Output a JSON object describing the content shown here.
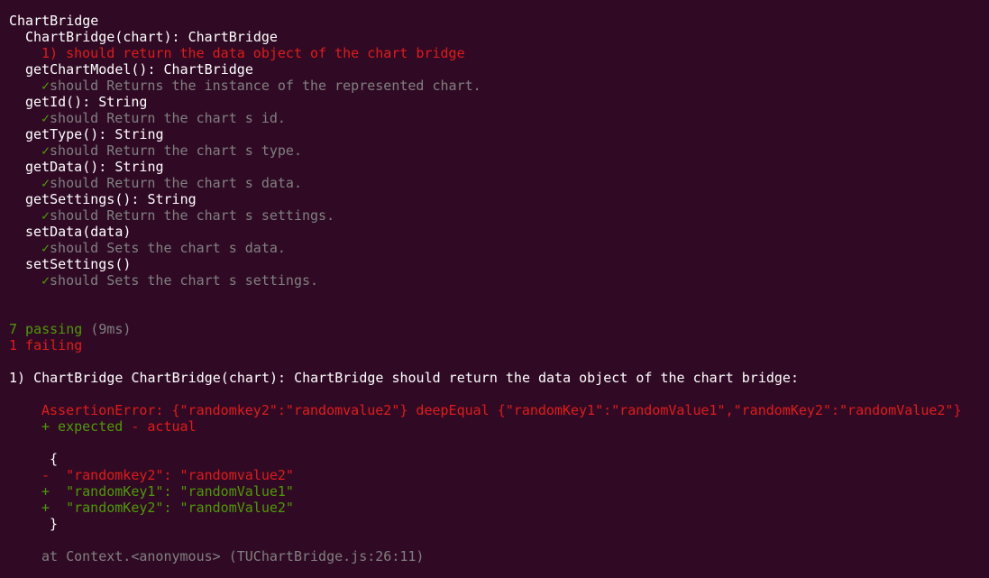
{
  "suite": {
    "title": "ChartBridge",
    "groups": [
      {
        "heading": "ChartBridge(chart): ChartBridge",
        "status": "fail",
        "marker": "1)",
        "test": "should return the data object of the chart bridge"
      },
      {
        "heading": "getChartModel(): ChartBridge",
        "status": "pass",
        "marker": "✓",
        "test": "should Returns the instance of the represented chart."
      },
      {
        "heading": "getId(): String",
        "status": "pass",
        "marker": "✓",
        "test": "should Return the chart s id."
      },
      {
        "heading": "getType(): String",
        "status": "pass",
        "marker": "✓",
        "test": "should Return the chart s type."
      },
      {
        "heading": "getData(): String",
        "status": "pass",
        "marker": "✓",
        "test": "should Return the chart s data."
      },
      {
        "heading": "getSettings(): String",
        "status": "pass",
        "marker": "✓",
        "test": "should Return the chart s settings."
      },
      {
        "heading": "setData(data)",
        "status": "pass",
        "marker": "✓",
        "test": "should Sets the chart s data."
      },
      {
        "heading": "setSettings()",
        "status": "pass",
        "marker": "✓",
        "test": "should Sets the chart s settings."
      }
    ]
  },
  "summary": {
    "passing": "7 passing",
    "duration": "(9ms)",
    "failing": "1 failing"
  },
  "failure": {
    "title": "1) ChartBridge ChartBridge(chart): ChartBridge should return the data object of the chart bridge:",
    "assertion": "AssertionError: {\"randomkey2\":\"randomvalue2\"} deepEqual {\"randomKey1\":\"randomValue1\",\"randomKey2\":\"randomValue2\"}",
    "legend_expected": "+ expected",
    "legend_actual": "- actual",
    "diff_open": "{",
    "diff": [
      {
        "sign": "-",
        "text": "\"randomkey2\": \"randomvalue2\""
      },
      {
        "sign": "+",
        "text": "\"randomKey1\": \"randomValue1\""
      },
      {
        "sign": "+",
        "text": "\"randomKey2\": \"randomValue2\""
      }
    ],
    "diff_close": "}",
    "stack": "at Context.<anonymous> (TUChartBridge.js:26:11)"
  }
}
